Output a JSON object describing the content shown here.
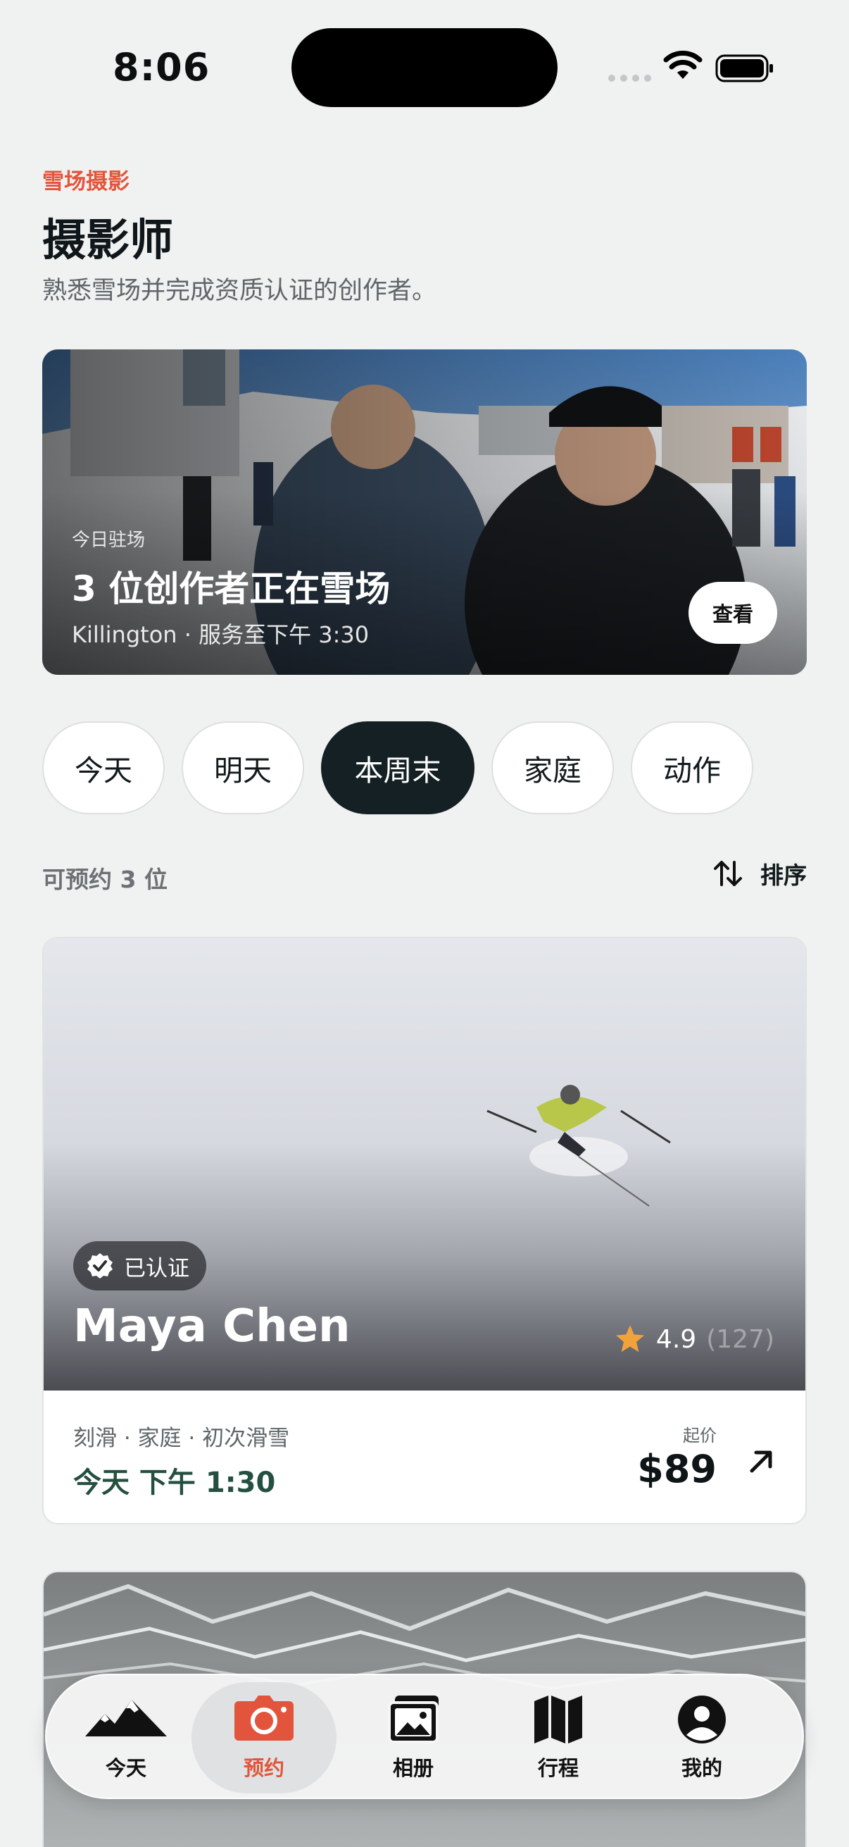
{
  "status_bar": {
    "time": "8:06"
  },
  "header": {
    "eyebrow": "雪场摄影",
    "title": "摄影师",
    "subtitle": "熟悉雪场并完成资质认证的创作者。"
  },
  "hero": {
    "kicker": "今日驻场",
    "headline": "3 位创作者正在雪场",
    "meta": "Killington · 服务至下午 3:30",
    "view_label": "查看"
  },
  "filters": [
    {
      "label": "今天",
      "active": false
    },
    {
      "label": "明天",
      "active": false
    },
    {
      "label": "本周末",
      "active": true
    },
    {
      "label": "家庭",
      "active": false
    },
    {
      "label": "动作",
      "active": false
    }
  ],
  "list": {
    "count_label": "可预约 3 位",
    "sort_label": "排序"
  },
  "cards": [
    {
      "verified_label": "已认证",
      "name": "Maya Chen",
      "rating": "4.9",
      "rating_count": "(127)",
      "tags": "刻滑 · 家庭 · 初次滑雪",
      "time": "今天 下午 1:30",
      "price_label": "起价",
      "price": "$89"
    }
  ],
  "tabbar": {
    "items": [
      {
        "label": "今天",
        "icon": "mountains-icon"
      },
      {
        "label": "预约",
        "icon": "camera-icon",
        "active": true
      },
      {
        "label": "相册",
        "icon": "photo-album-icon"
      },
      {
        "label": "行程",
        "icon": "map-icon"
      },
      {
        "label": "我的",
        "icon": "person-icon"
      }
    ]
  },
  "colors": {
    "accent": "#e2553c",
    "chip_active": "#142024",
    "time_green": "#24503f",
    "star": "#f2a23a"
  }
}
